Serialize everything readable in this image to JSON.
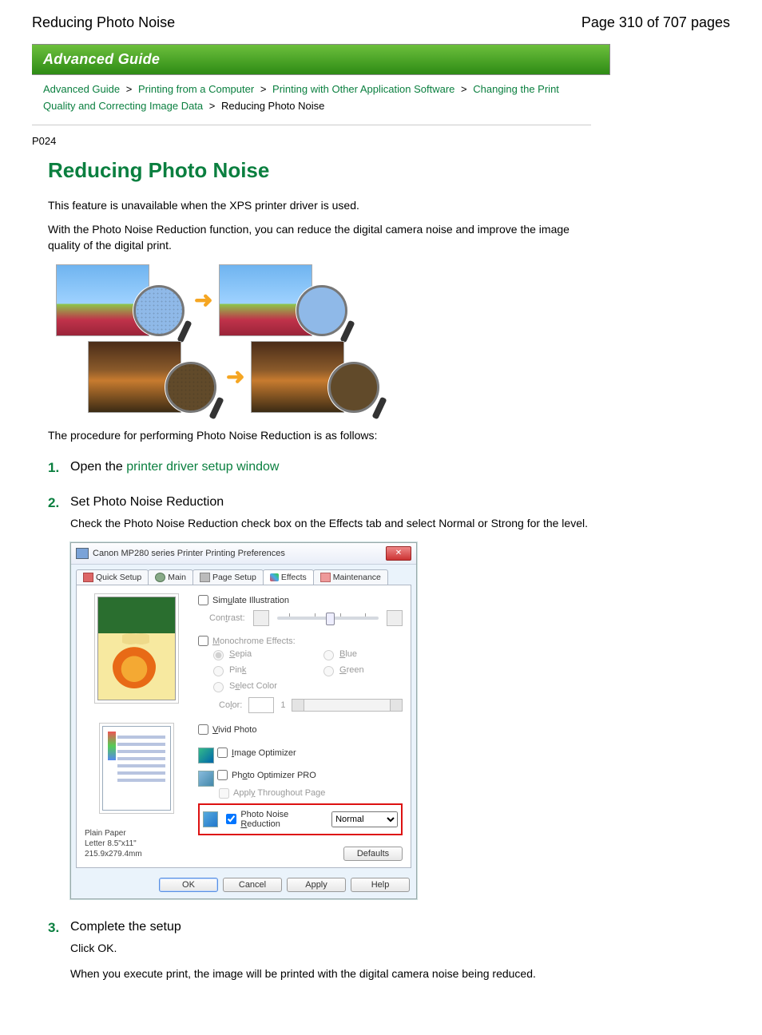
{
  "header": {
    "title": "Reducing Photo Noise",
    "pageinfo": "Page 310 of 707 pages"
  },
  "banner": "Advanced Guide",
  "breadcrumbs": {
    "items": [
      "Advanced Guide",
      "Printing from a Computer",
      "Printing with Other Application Software",
      "Changing the Print Quality and Correcting Image Data"
    ],
    "current": "Reducing Photo Noise",
    "sep": ">"
  },
  "pcode": "P024",
  "title": "Reducing Photo Noise",
  "intro1": "This feature is unavailable when the XPS printer driver is used.",
  "intro2": "With the Photo Noise Reduction function, you can reduce the digital camera noise and improve the image quality of the digital print.",
  "procedure_lead": "The procedure for performing Photo Noise Reduction is as follows:",
  "steps": {
    "s1": {
      "prefix": "Open the ",
      "link": "printer driver setup window"
    },
    "s2": {
      "title": "Set Photo Noise Reduction",
      "text": "Check the Photo Noise Reduction check box on the Effects tab and select Normal or Strong for the level."
    },
    "s3": {
      "title": "Complete the setup",
      "text1": "Click OK.",
      "text2": "When you execute print, the image will be printed with the digital camera noise being reduced."
    }
  },
  "dialog": {
    "title": "Canon MP280 series Printer Printing Preferences",
    "tabs": {
      "quick": "Quick Setup",
      "main": "Main",
      "page": "Page Setup",
      "effects": "Effects",
      "maint": "Maintenance"
    },
    "simulate": "Simulate Illustration",
    "contrast": "Contrast:",
    "mono": "Monochrome Effects:",
    "radios": {
      "sepia": "Sepia",
      "blue": "Blue",
      "pink": "Pink",
      "green": "Green",
      "select": "Select Color"
    },
    "color_label": "Color:",
    "color_value": "1",
    "vivid": "Vivid Photo",
    "imgopt": "Image Optimizer",
    "pro": "Photo Optimizer PRO",
    "apply": "Apply Throughout Page",
    "pnr": "Photo Noise Reduction",
    "pnr_level": "Normal",
    "media1": "Plain Paper",
    "media2": "Letter 8.5\"x11\" 215.9x279.4mm",
    "defaults": "Defaults",
    "buttons": {
      "ok": "OK",
      "cancel": "Cancel",
      "apply": "Apply",
      "help": "Help"
    }
  }
}
